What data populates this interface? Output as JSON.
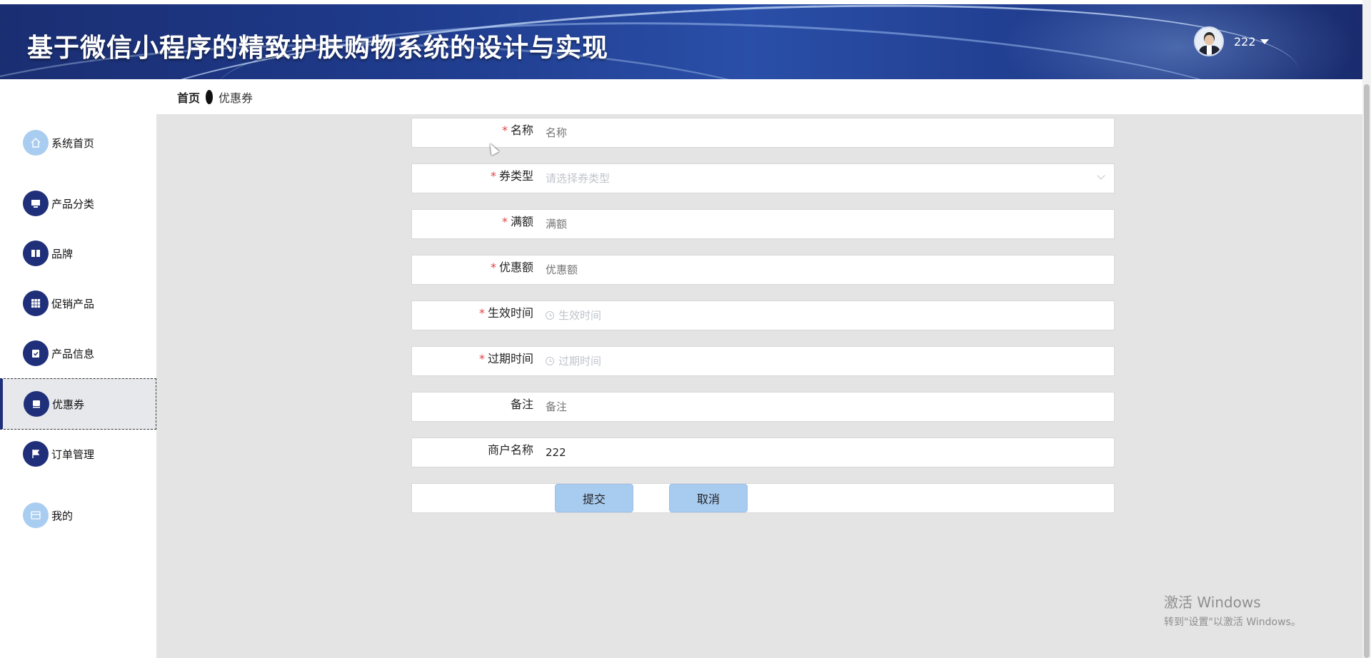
{
  "header": {
    "title": "基于微信小程序的精致护肤购物系统的设计与实现",
    "user_name": "222"
  },
  "breadcrumb": {
    "home": "首页",
    "current": "优惠券"
  },
  "sidebar": {
    "items": [
      {
        "label": "系统首页",
        "icon": "home-icon"
      },
      {
        "label": "产品分类",
        "icon": "monitor-icon"
      },
      {
        "label": "品牌",
        "icon": "book-icon"
      },
      {
        "label": "促销产品",
        "icon": "grid-icon"
      },
      {
        "label": "产品信息",
        "icon": "clipboard-check-icon"
      },
      {
        "label": "优惠券",
        "icon": "ticket-icon",
        "active": true
      },
      {
        "label": "订单管理",
        "icon": "flag-icon"
      },
      {
        "label": "我的",
        "icon": "wallet-icon"
      }
    ]
  },
  "form": {
    "name": {
      "label": "名称",
      "placeholder": "名称",
      "required": true
    },
    "coupon_type": {
      "label": "券类型",
      "placeholder": "请选择券类型",
      "required": true
    },
    "threshold": {
      "label": "满额",
      "placeholder": "满额",
      "required": true
    },
    "discount": {
      "label": "优惠额",
      "placeholder": "优惠额",
      "required": true
    },
    "start_time": {
      "label": "生效时间",
      "placeholder": "生效时间",
      "required": true
    },
    "end_time": {
      "label": "过期时间",
      "placeholder": "过期时间",
      "required": true
    },
    "remark": {
      "label": "备注",
      "placeholder": "备注",
      "required": false
    },
    "merchant": {
      "label": "商户名称",
      "value": "222",
      "required": false
    },
    "required_mark": "*",
    "submit_label": "提交",
    "cancel_label": "取消"
  },
  "watermark": {
    "line1": "激活 Windows",
    "line2": "转到\"设置\"以激活 Windows。"
  },
  "colors": {
    "header_bg": "#1f3b8c",
    "sidebar_icon": "#1f2f7a",
    "main_bg": "#e4e4e4",
    "button_bg": "#a8cbf0",
    "required": "#e04040"
  }
}
